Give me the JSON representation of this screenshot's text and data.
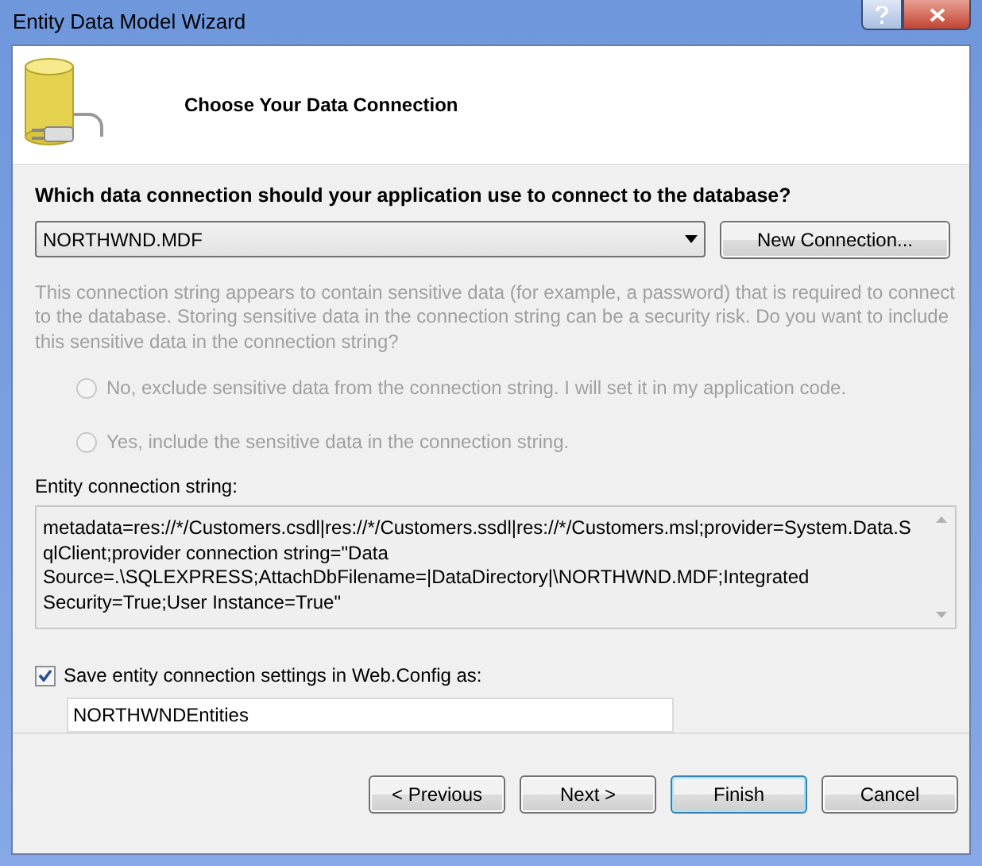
{
  "window": {
    "title": "Entity Data Model Wizard"
  },
  "header": {
    "title": "Choose Your Data Connection"
  },
  "question": "Which data connection should your application use to connect to the database?",
  "connection": {
    "value": "NORTHWND.MDF",
    "new_button": "New Connection..."
  },
  "sensitive": {
    "text": "This connection string appears to contain sensitive data (for example, a password) that is required to connect to the database. Storing sensitive data in the connection string can be a security risk. Do you want to include this sensitive data in the connection string?",
    "disabled": true,
    "options": [
      {
        "label": "No, exclude sensitive data from the connection string. I will set it in my application code.",
        "selected": false,
        "disabled": true
      },
      {
        "label": "Yes, include the sensitive data in the connection string.",
        "selected": false,
        "disabled": true
      }
    ]
  },
  "entity_string": {
    "label": "Entity connection string:",
    "value": "metadata=res://*/Customers.csdl|res://*/Customers.ssdl|res://*/Customers.msl;provider=System.Data.SqlClient;provider connection string=\"Data Source=.\\SQLEXPRESS;AttachDbFilename=|DataDirectory|\\NORTHWND.MDF;Integrated Security=True;User Instance=True\""
  },
  "save": {
    "label": "Save entity connection settings in Web.Config as:",
    "checked": true,
    "value": "NORTHWNDEntities"
  },
  "buttons": [
    {
      "label": "< Previous",
      "default": false
    },
    {
      "label": "Next >",
      "default": false
    },
    {
      "label": "Finish",
      "default": true
    },
    {
      "label": "Cancel",
      "default": false
    }
  ]
}
